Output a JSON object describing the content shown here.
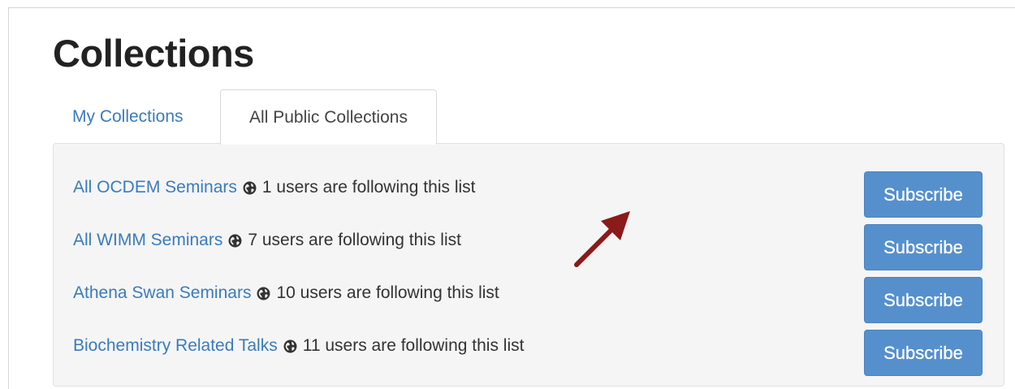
{
  "page": {
    "title": "Collections"
  },
  "tabs": [
    {
      "label": "My Collections",
      "active": false
    },
    {
      "label": "All Public Collections",
      "active": true
    }
  ],
  "collections": [
    {
      "name": "All OCDEM Seminars",
      "icon": "globe-icon",
      "followers": "1 users are following this list",
      "button": "Subscribe"
    },
    {
      "name": "All WIMM Seminars",
      "icon": "globe-icon",
      "followers": "7 users are following this list",
      "button": "Subscribe"
    },
    {
      "name": "Athena Swan Seminars",
      "icon": "globe-icon",
      "followers": "10 users are following this list",
      "button": "Subscribe"
    },
    {
      "name": "Biochemistry Related Talks",
      "icon": "globe-icon",
      "followers": "11 users are following this list",
      "button": "Subscribe"
    }
  ],
  "colors": {
    "link": "#3a7bbf",
    "button": "#5590cd",
    "panel": "#f5f5f5",
    "annotation_arrow": "#8b1a1a"
  }
}
